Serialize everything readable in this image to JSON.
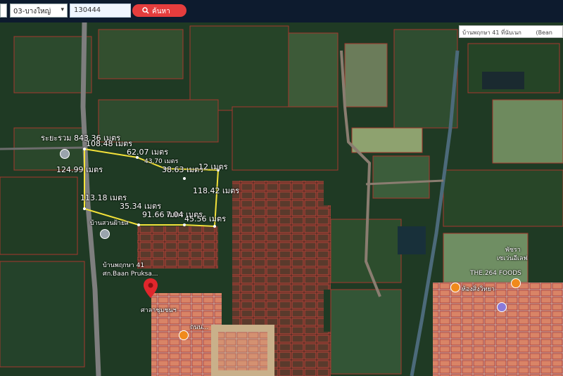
{
  "toolbar": {
    "province_select": "",
    "district_select": "03-บางใหญ่",
    "parcel_input": "130444",
    "search_button": "ค้นหา"
  },
  "map": {
    "place_search": "บ้านพฤกษา 41 ที่นับเนก",
    "place_search_tag": "(Bean",
    "total_distance_label": "ระยะรวม 843.36 เมตร",
    "measurements": [
      "108.48 เมตร",
      "62.07 เมตร",
      "43.70 เมตร",
      "38.63 เมตร",
      "12 เมตร",
      "124.99 เมตร",
      "118.42 เมตร",
      "113.18 เมตร",
      "35.34 เมตร",
      "91.66 เมตร",
      "7.04 เมตร",
      "45.56 เมตร"
    ],
    "places": {
      "village_north": "บ้านสวนฝ้ายส",
      "pruksa_a": "บ้านพฤกษา 41",
      "pruksa_b": "ศก.Baan Pruksa...",
      "community": "ศาลาชุมชนฯ",
      "road_label": "ถนน...",
      "market_a": "พัชรา",
      "market_b": "เซเว่นอีเลฟ",
      "food": "THE.264 FOODS",
      "shop": "ห้องสิ่งวิทยา"
    },
    "colors": {
      "parcel_outline": "#b33a2e",
      "selection_outline": "#f4e23a",
      "marker": "#e0262c"
    }
  }
}
